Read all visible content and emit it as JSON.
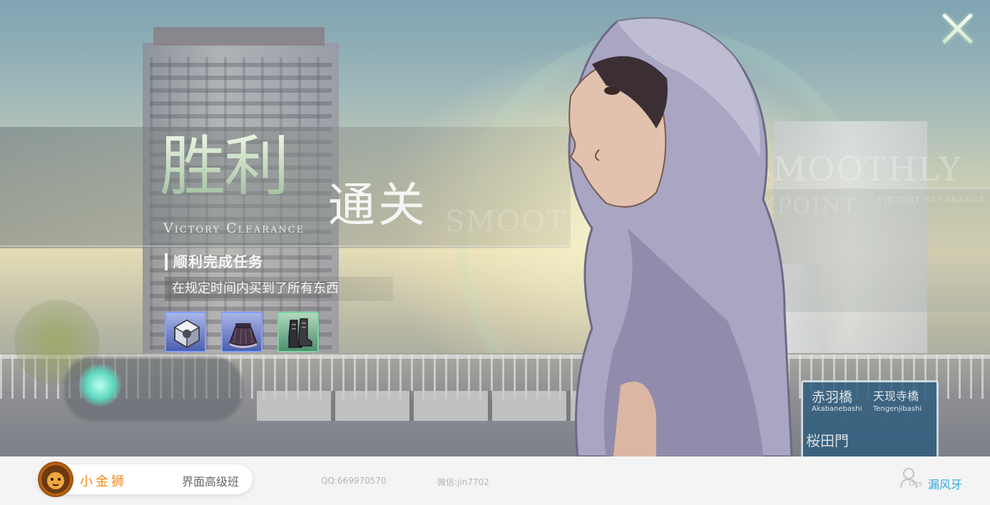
{
  "dialog": {
    "title_main": "胜利",
    "title_sub": "通关",
    "title_en": "Victory Clearance",
    "mission_heading": "顺利完成任务",
    "mission_description": "在规定时间内买到了所有东西",
    "ghost_text_1": "SMOOT",
    "ghost_text_2": "SMOOTHLY",
    "ghost_text_3": "CKPOINT",
    "ghost_text_4": "VICTORY CLEARANCE",
    "close_label": "X",
    "reward_items": [
      {
        "icon": "gem-cube-icon",
        "rarity_color": "#7fa0ff"
      },
      {
        "icon": "skirt-icon",
        "rarity_color": "#7fa0ff"
      },
      {
        "icon": "boots-icon",
        "rarity_color": "#7fd2a4"
      }
    ]
  },
  "background": {
    "road_sign": {
      "line1": "赤羽橋",
      "line1b": "天现寺橋",
      "line2": "Akabanebashi",
      "line2b": "Tengenjibashi",
      "line3": "桜田門"
    }
  },
  "footer": {
    "brand": "小金狮",
    "course": "界面高级班",
    "qq": "QQ:669970570",
    "wechat": "微信:jin7702",
    "des_label": "Des",
    "author": "漏风牙",
    "colors": {
      "brand": "#f08a1a",
      "author": "#35a8e0"
    }
  }
}
